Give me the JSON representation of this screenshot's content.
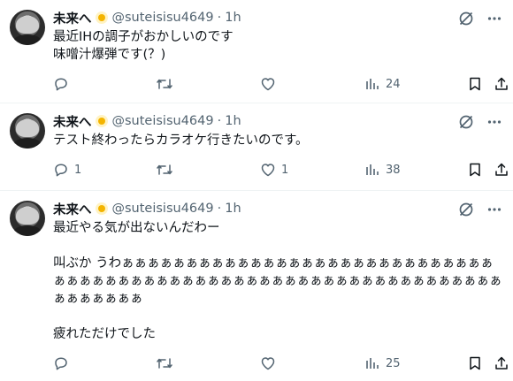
{
  "colors": {
    "text": "#0f1419",
    "muted": "#536471",
    "divider": "#eff3f4",
    "badge": "#f4b400"
  },
  "tweets": [
    {
      "name": "未来へ",
      "badge_icon": "sun-emoji-badge",
      "handle": "@suteisisu4649",
      "sep": "·",
      "time": "1h",
      "text": "最近IHの調子がおかしいのです\n味噌汁爆弾です(？)",
      "replies": "",
      "retweets": "",
      "likes": "",
      "views": "24"
    },
    {
      "name": "未来へ",
      "badge_icon": "sun-emoji-badge",
      "handle": "@suteisisu4649",
      "sep": "·",
      "time": "1h",
      "text": "テスト終わったらカラオケ行きたいのです。",
      "replies": "1",
      "retweets": "",
      "likes": "1",
      "views": "38"
    },
    {
      "name": "未来へ",
      "badge_icon": "sun-emoji-badge",
      "handle": "@suteisisu4649",
      "sep": "·",
      "time": "1h",
      "text": "最近やる気が出ないんだわー\n\n叫ぶか うわぁぁぁぁぁぁぁぁぁぁぁぁぁぁぁぁぁぁぁぁぁぁぁぁぁぁぁぁぁぁぁぁぁぁぁぁぁぁぁぁぁぁぁぁぁぁぁぁぁぁぁぁぁぁぁぁぁぁぁぁぁぁぁぁぁぁぁぁぁぁぁ\n\n疲れただけでした",
      "replies": "",
      "retweets": "",
      "likes": "",
      "views": "25"
    }
  ]
}
